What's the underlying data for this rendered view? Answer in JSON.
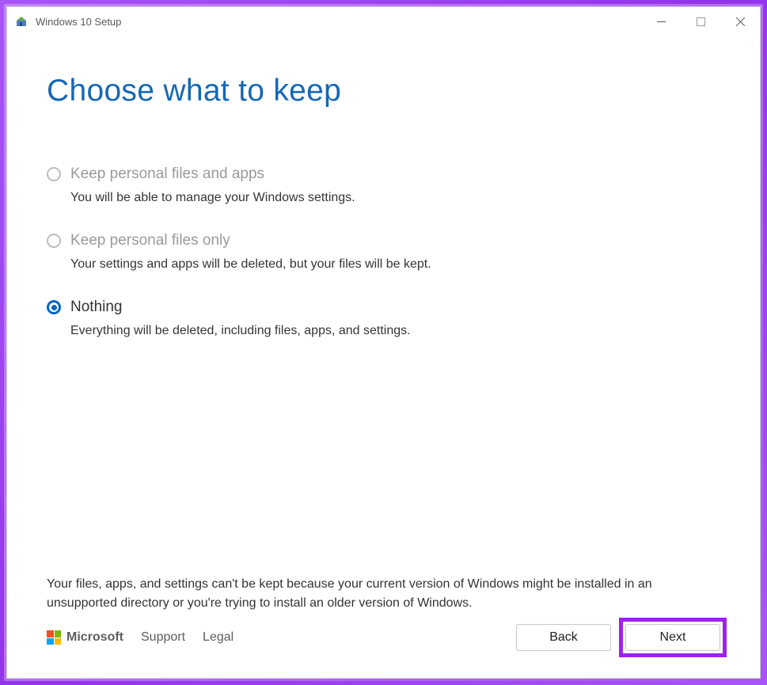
{
  "window": {
    "title": "Windows 10 Setup"
  },
  "main": {
    "heading": "Choose what to keep"
  },
  "options": [
    {
      "label": "Keep personal files and apps",
      "description": "You will be able to manage your Windows settings.",
      "selected": false,
      "disabled": true
    },
    {
      "label": "Keep personal files only",
      "description": "Your settings and apps will be deleted, but your files will be kept.",
      "selected": false,
      "disabled": true
    },
    {
      "label": "Nothing",
      "description": "Everything will be deleted, including files, apps, and settings.",
      "selected": true,
      "disabled": false
    }
  ],
  "footer": {
    "note": "Your files, apps, and settings can't be kept because your current version of Windows might be installed in an unsupported directory or you're trying to install an older version of Windows.",
    "brand": "Microsoft",
    "support_label": "Support",
    "legal_label": "Legal",
    "back_label": "Back",
    "next_label": "Next"
  }
}
